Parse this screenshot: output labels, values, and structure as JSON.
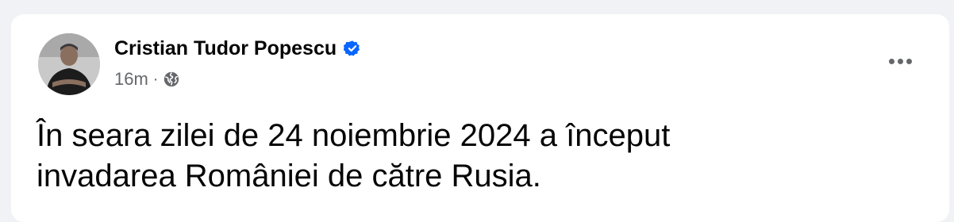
{
  "post": {
    "author": {
      "name": "Cristian Tudor Popescu",
      "verified": true,
      "avatar_icon": "profile-photo"
    },
    "meta": {
      "time": "16m",
      "separator": "·",
      "audience_icon": "globe-icon"
    },
    "text_lines": [
      "În seara zilei de 24 noiembrie 2024 a început",
      "invadarea României de către Rusia."
    ],
    "menu_icon": "more-options-icon"
  },
  "colors": {
    "page_background": "#f0f2f5",
    "card_background": "#ffffff",
    "verified_badge": "#0866ff",
    "secondary_text": "#65676b",
    "primary_text": "#050505"
  }
}
